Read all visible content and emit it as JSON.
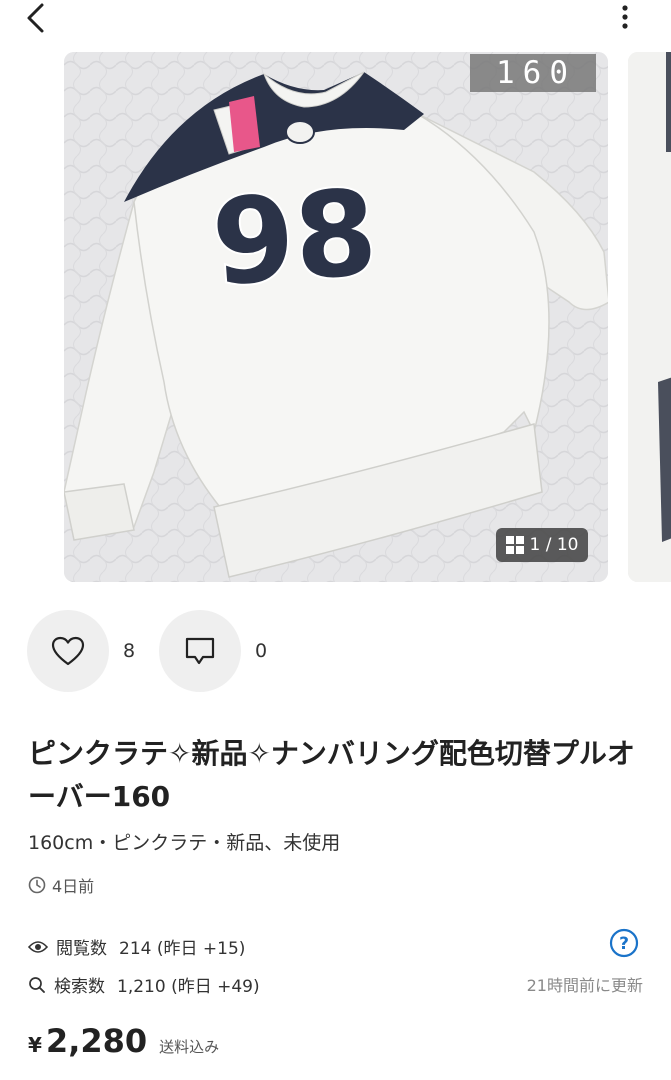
{
  "photo": {
    "size_tag": "160",
    "counter": "1 / 10"
  },
  "reactions": {
    "likes": "8",
    "comments": "0"
  },
  "item": {
    "title": "ピンクラテ✧新品✧ナンバリング配色切替プルオーバー160",
    "meta": "160cm・ピンクラテ・新品、未使用",
    "posted": "4日前"
  },
  "stats": {
    "views_label": "閲覧数",
    "views_value": "214 (昨日 +15)",
    "search_label": "検索数",
    "search_value": "1,210 (昨日 +49)",
    "updated": "21時間前に更新"
  },
  "price": {
    "currency": "¥",
    "value": "2,280",
    "note": "送料込み"
  },
  "icons": {
    "back": "chevron-left-icon",
    "more": "more-vertical-icon",
    "like": "heart-icon",
    "comment": "comment-icon",
    "gallery": "grid-icon",
    "clock": "clock-icon",
    "views": "eye-icon",
    "search": "search-icon",
    "help": "question-circle-icon"
  },
  "colors": {
    "accent_blue": "#1a73c9",
    "text": "#222222",
    "muted": "#8a8a8a"
  }
}
